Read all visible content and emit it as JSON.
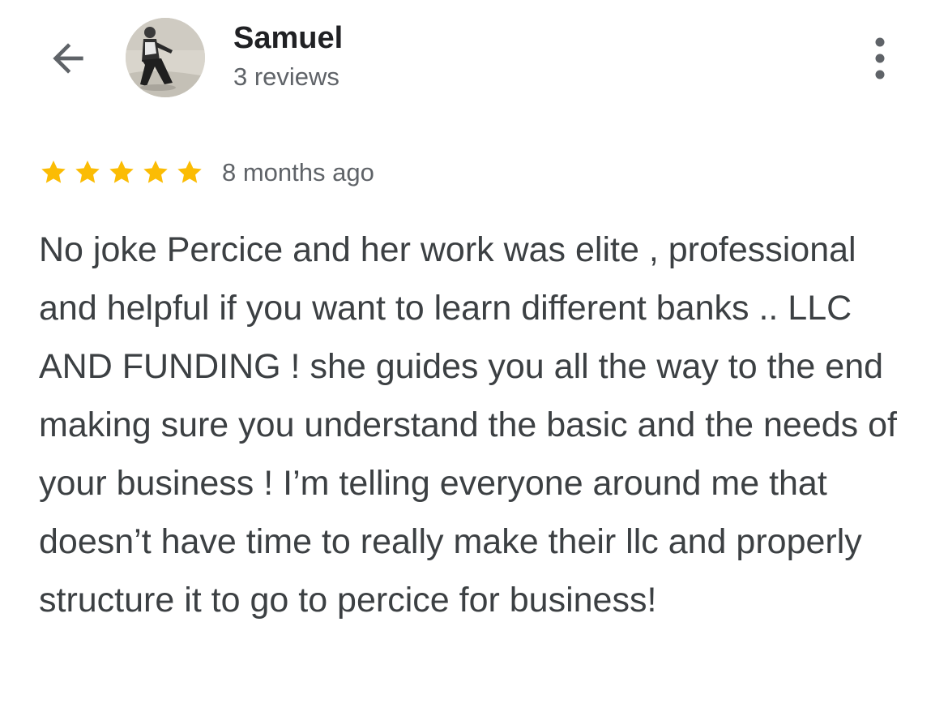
{
  "header": {
    "back_icon": "arrow-back-icon",
    "avatar_icon": "profile-photo",
    "user_name": "Samuel",
    "review_count": "3 reviews",
    "more_icon": "more-vert-icon"
  },
  "review": {
    "rating": 5,
    "rating_max": 5,
    "star_color": "#FBBC04",
    "time_ago": "8 months ago",
    "text": "No joke Percice and her work was elite , professional and helpful if you want to learn different banks .. LLC AND FUNDING ! she guides you all the way to the end making sure you understand the basic and the needs of your business ! I’m telling everyone around me that doesn’t have time to really make their llc and properly structure it to go to percice for business!"
  }
}
